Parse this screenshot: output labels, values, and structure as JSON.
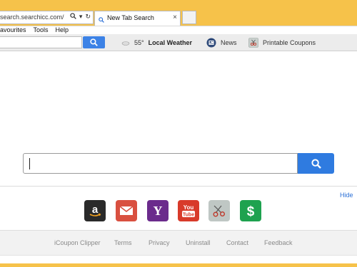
{
  "browser": {
    "address": "search.searchicc.com/",
    "tab_title": "New Tab Search",
    "menu": [
      "avourites",
      "Tools",
      "Help"
    ]
  },
  "toolbar": {
    "search_placeholder": "",
    "weather_temp": "55°",
    "weather_label": "Local Weather",
    "news_label": "News",
    "coupons_label": "Printable Coupons"
  },
  "main": {
    "search_value": "",
    "hide_label": "Hide"
  },
  "quick_links": [
    {
      "name": "amazon",
      "glyph": "a"
    },
    {
      "name": "mail",
      "glyph": ""
    },
    {
      "name": "yahoo",
      "glyph": "Y"
    },
    {
      "name": "youtube",
      "glyph": "You Tube"
    },
    {
      "name": "coupons",
      "glyph": ""
    },
    {
      "name": "dollar",
      "glyph": "$"
    }
  ],
  "footer": {
    "links": [
      "iCoupon Clipper",
      "Terms",
      "Privacy",
      "Uninstall",
      "Contact",
      "Feedback"
    ]
  },
  "colors": {
    "chrome": "#f6c24a",
    "accent_blue": "#2f7be0",
    "link_blue": "#2a6fd6"
  }
}
